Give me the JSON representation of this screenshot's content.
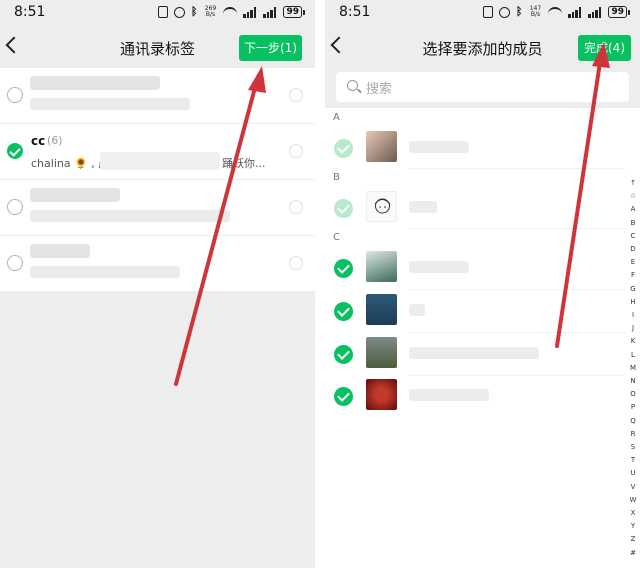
{
  "left_screen": {
    "status": {
      "time": "8:51",
      "speed": "269 B/s",
      "battery": "99"
    },
    "nav": {
      "title": "通讯录标签",
      "next_button": "下一步(1)"
    },
    "rows": [
      {
        "checked": false
      },
      {
        "checked": true,
        "name": "cc",
        "count": "(6)",
        "preview": "chalina 🌻 , 晨",
        "preview_tail": "踊跃你..."
      },
      {
        "checked": false
      },
      {
        "checked": false
      }
    ]
  },
  "right_screen": {
    "status": {
      "time": "8:51",
      "speed": "147 B/s",
      "battery": "99"
    },
    "nav": {
      "title": "选择要添加的成员",
      "done_button": "完成(4)"
    },
    "search": {
      "placeholder": "搜索"
    },
    "sections": [
      {
        "letter": "A",
        "members": [
          {
            "selected": true,
            "locked": true
          }
        ]
      },
      {
        "letter": "B",
        "members": [
          {
            "selected": true,
            "locked": true
          }
        ]
      },
      {
        "letter": "C",
        "members": [
          {
            "selected": true,
            "locked": false
          },
          {
            "selected": true,
            "locked": false
          },
          {
            "selected": true,
            "locked": false
          },
          {
            "selected": true,
            "locked": false
          }
        ]
      }
    ],
    "index_letters": [
      "↑",
      "☆",
      "A",
      "B",
      "C",
      "D",
      "E",
      "F",
      "G",
      "H",
      "I",
      "J",
      "K",
      "L",
      "M",
      "N",
      "O",
      "P",
      "Q",
      "R",
      "S",
      "T",
      "U",
      "V",
      "W",
      "X",
      "Y",
      "Z",
      "#"
    ]
  },
  "colors": {
    "accent": "#07c160",
    "annotation_arrow": "#d0343a"
  }
}
